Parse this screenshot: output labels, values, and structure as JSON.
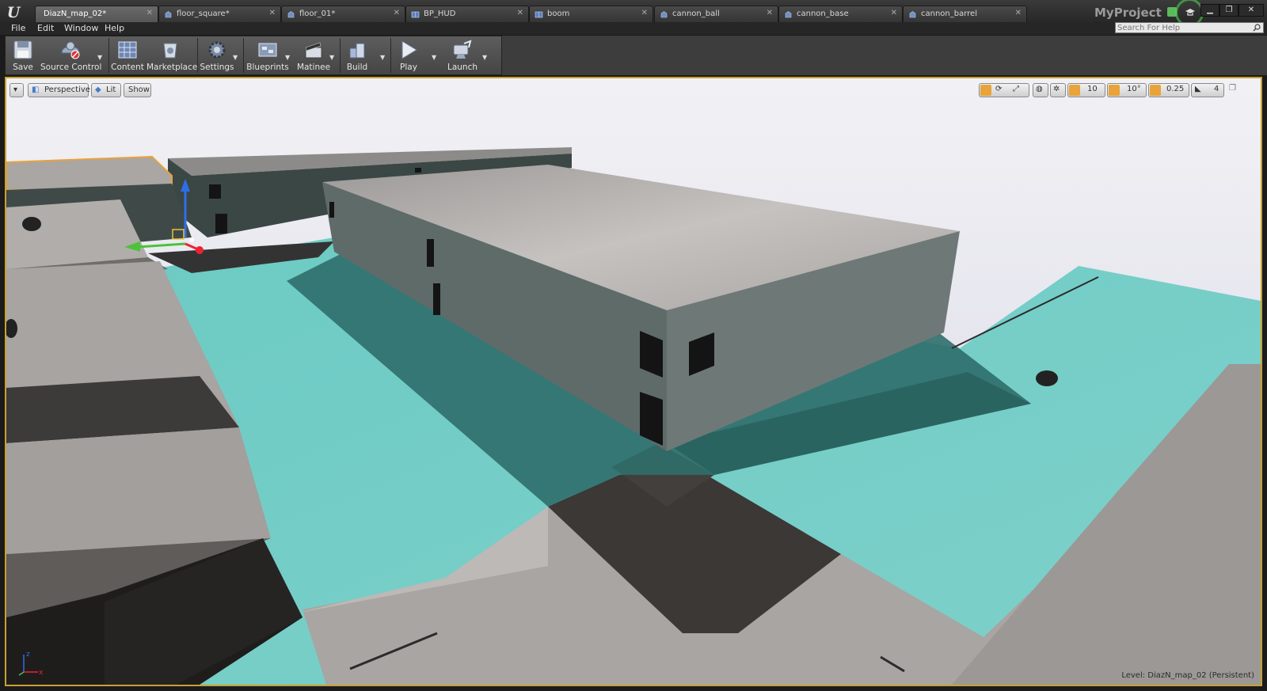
{
  "window": {
    "project_name": "MyProject",
    "tabs": [
      {
        "label": "DiazN_map_02*",
        "icon": "level-icon",
        "active": true
      },
      {
        "label": "floor_square*",
        "icon": "static-mesh-icon",
        "active": false
      },
      {
        "label": "floor_01*",
        "icon": "static-mesh-icon",
        "active": false
      },
      {
        "label": "BP_HUD",
        "icon": "blueprint-icon",
        "active": false
      },
      {
        "label": "boom",
        "icon": "blueprint-icon",
        "active": false
      },
      {
        "label": "cannon_ball",
        "icon": "static-mesh-icon",
        "active": false
      },
      {
        "label": "cannon_base",
        "icon": "static-mesh-icon",
        "active": false
      },
      {
        "label": "cannon_barrel",
        "icon": "static-mesh-icon",
        "active": false
      }
    ],
    "controls": {
      "minimize": "▁",
      "restore": "❐",
      "close": "✕"
    }
  },
  "menu": {
    "items": [
      "File",
      "Edit",
      "Window",
      "Help"
    ],
    "search": {
      "placeholder": "Search For Help",
      "value": ""
    }
  },
  "toolbar": {
    "buttons": [
      {
        "label": "Save",
        "icon": "save-icon",
        "dropdown": false
      },
      {
        "label": "Source Control",
        "icon": "source-control-icon",
        "dropdown": true
      },
      {
        "label": "Content",
        "icon": "content-browser-icon",
        "dropdown": false
      },
      {
        "label": "Marketplace",
        "icon": "marketplace-icon",
        "dropdown": false
      },
      {
        "label": "Settings",
        "icon": "settings-icon",
        "dropdown": true
      },
      {
        "label": "Blueprints",
        "icon": "blueprints-icon",
        "dropdown": true
      },
      {
        "label": "Matinee",
        "icon": "matinee-icon",
        "dropdown": true
      },
      {
        "label": "Build",
        "icon": "build-icon",
        "dropdown": true
      },
      {
        "label": "Play",
        "icon": "play-icon",
        "dropdown": true
      },
      {
        "label": "Launch",
        "icon": "launch-icon",
        "dropdown": true
      }
    ]
  },
  "viewport": {
    "view_mode": "Perspective",
    "lighting_mode": "Lit",
    "show_label": "Show",
    "grid_snap": "10",
    "rotation_snap": "10°",
    "scale_snap": "0.25",
    "camera_speed": "4",
    "level_text": "Level:  DiazN_map_02 (Persistent)",
    "axis_labels": {
      "z": "z",
      "x": "x"
    },
    "colors": {
      "selection_border": "#c9a132",
      "floor_cyan": "#6fc6c0",
      "active_snap": "#e8a33a"
    }
  }
}
